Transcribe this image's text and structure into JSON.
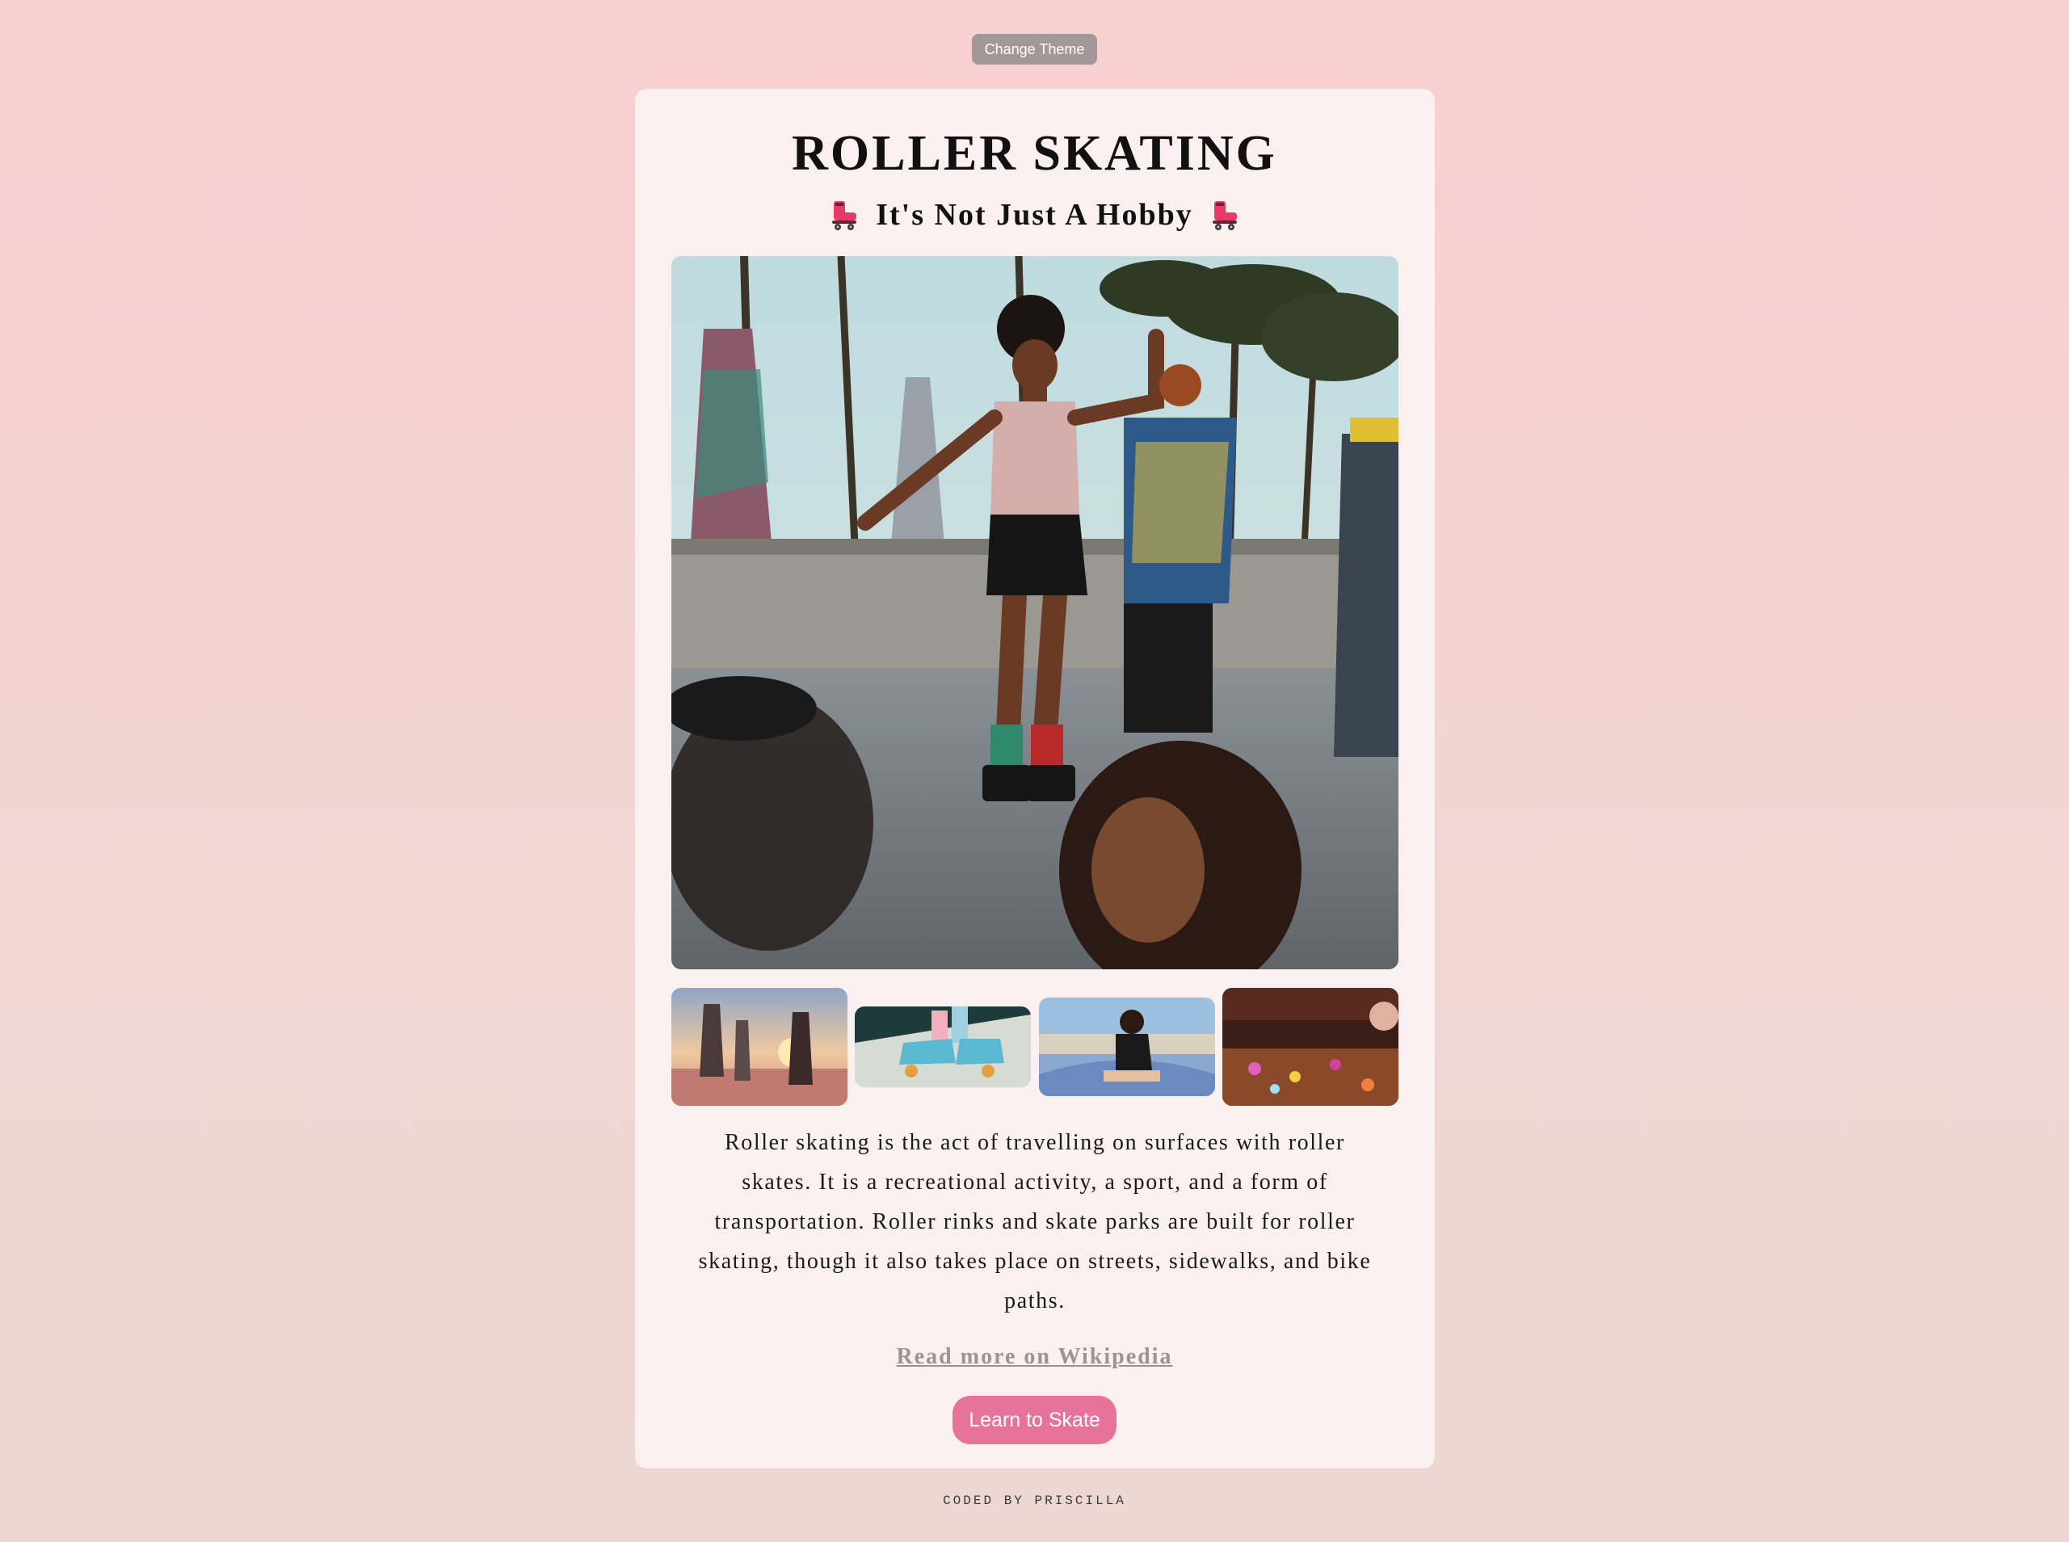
{
  "controls": {
    "change_theme_label": "Change Theme"
  },
  "header": {
    "title": "ROLLER SKATING",
    "subtitle": "It's Not Just A Hobby",
    "subtitle_icon": "roller-skate-emoji"
  },
  "gallery": {
    "hero_alt": "Woman roller skating on a boardwalk with palm trees",
    "thumbnails": [
      {
        "alt": "Group of skaters at sunset"
      },
      {
        "alt": "Close-up of blue roller skates"
      },
      {
        "alt": "Skater sitting on a skate ramp"
      },
      {
        "alt": "Indoor roller rink with lights"
      }
    ]
  },
  "content": {
    "description": "Roller skating is the act of travelling on surfaces with roller skates. It is a recreational activity, a sport, and a form of transportation. Roller rinks and skate parks are built for roller skating, though it also takes place on streets, sidewalks, and bike paths.",
    "wiki_link_label": "Read more on Wikipedia",
    "cta_label": "Learn to Skate"
  },
  "footer": {
    "credit": "CODED BY PRISCILLA"
  },
  "colors": {
    "background": "#f8cfcf",
    "card": "#f9f0ef",
    "accent_button": "#e8739a",
    "theme_button": "#a39898",
    "link": "#9d9393"
  }
}
